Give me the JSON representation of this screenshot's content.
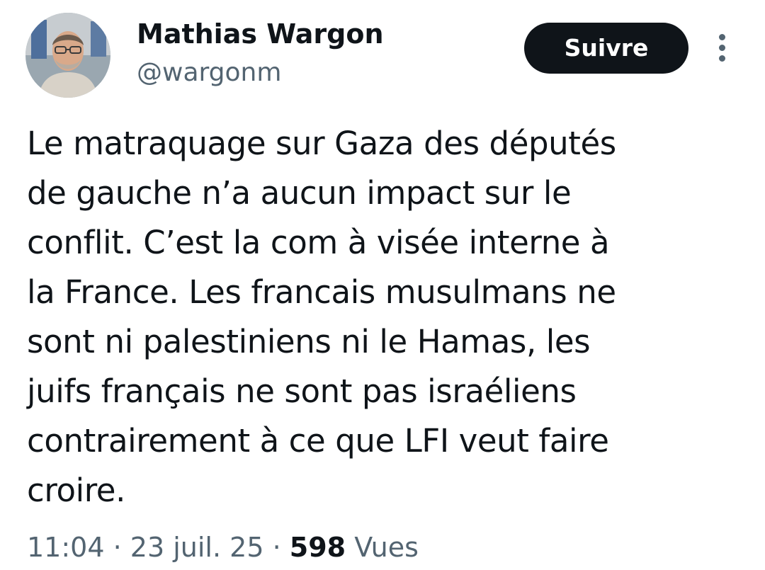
{
  "author": {
    "display_name": "Mathias Wargon",
    "handle": "@wargonm",
    "avatar_icon": "profile-photo"
  },
  "actions": {
    "follow_label": "Suivre",
    "more_icon": "more-vertical-icon"
  },
  "tweet": {
    "lines": [
      "Le matraquage sur Gaza des députés",
      "de gauche n’a aucun impact sur le",
      "conflit. C’est la com à visée interne à",
      "la France. Les francais musulmans ne",
      "sont ni palestiniens ni le Hamas, les",
      "juifs français ne sont pas israéliens",
      "contrairement à ce que LFI veut faire",
      "croire."
    ]
  },
  "meta": {
    "time": "11:04",
    "separator": "·",
    "date": "23 juil. 25",
    "views_count": "598",
    "views_label": "Vues"
  },
  "colors": {
    "text_primary": "#0f1419",
    "text_secondary": "#536471",
    "button_bg": "#0f1419",
    "button_text": "#ffffff"
  }
}
